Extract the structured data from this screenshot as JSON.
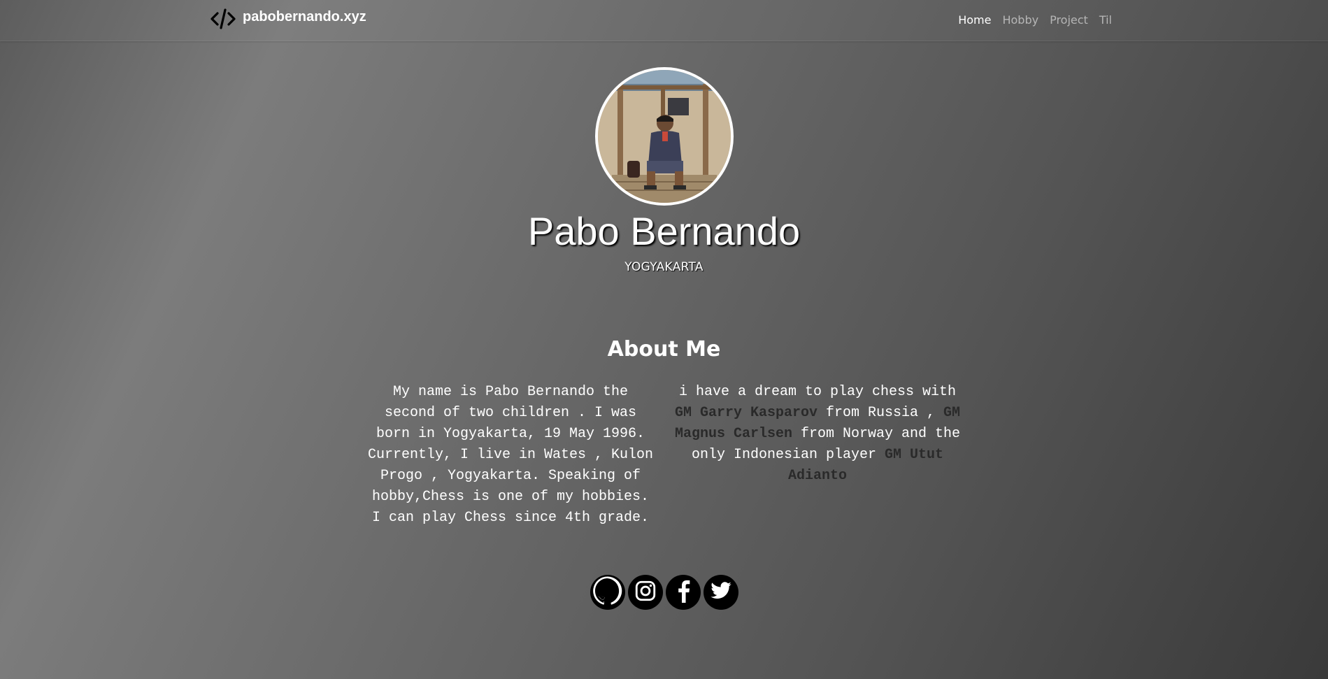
{
  "navbar": {
    "brand": "pabobernando.xyz",
    "brand_icon": "code-icon",
    "links": [
      {
        "label": "Home",
        "active": true
      },
      {
        "label": "Hobby",
        "active": false
      },
      {
        "label": "Project",
        "active": false
      },
      {
        "label": "Til",
        "active": false
      }
    ]
  },
  "header": {
    "name": "Pabo Bernando",
    "location": "YOGYAKARTA"
  },
  "about": {
    "title": "About Me",
    "left": "My name is Pabo Bernando the second of two children . I was born in Yogyakarta, 19 May 1996. Currently, I live in Wates , Kulon Progo , Yogyakarta. Speaking of hobby,Chess is one of my hobbies. I can play Chess since 4th grade.",
    "right": {
      "t1": "i have a dream to play chess with ",
      "gm1": "GM Garry Kasparov",
      "t2": " from Russia , ",
      "gm2": "GM Magnus Carlsen",
      "t3": " from Norway and the only Indonesian player ",
      "gm3": "GM Utut Adianto"
    }
  },
  "social": [
    {
      "icon": "github-icon"
    },
    {
      "icon": "instagram-icon"
    },
    {
      "icon": "facebook-icon"
    },
    {
      "icon": "twitter-icon"
    }
  ],
  "colors": {
    "text": "#ffffff",
    "highlight": "#2a2a2a",
    "icon_bg": "#000000"
  }
}
